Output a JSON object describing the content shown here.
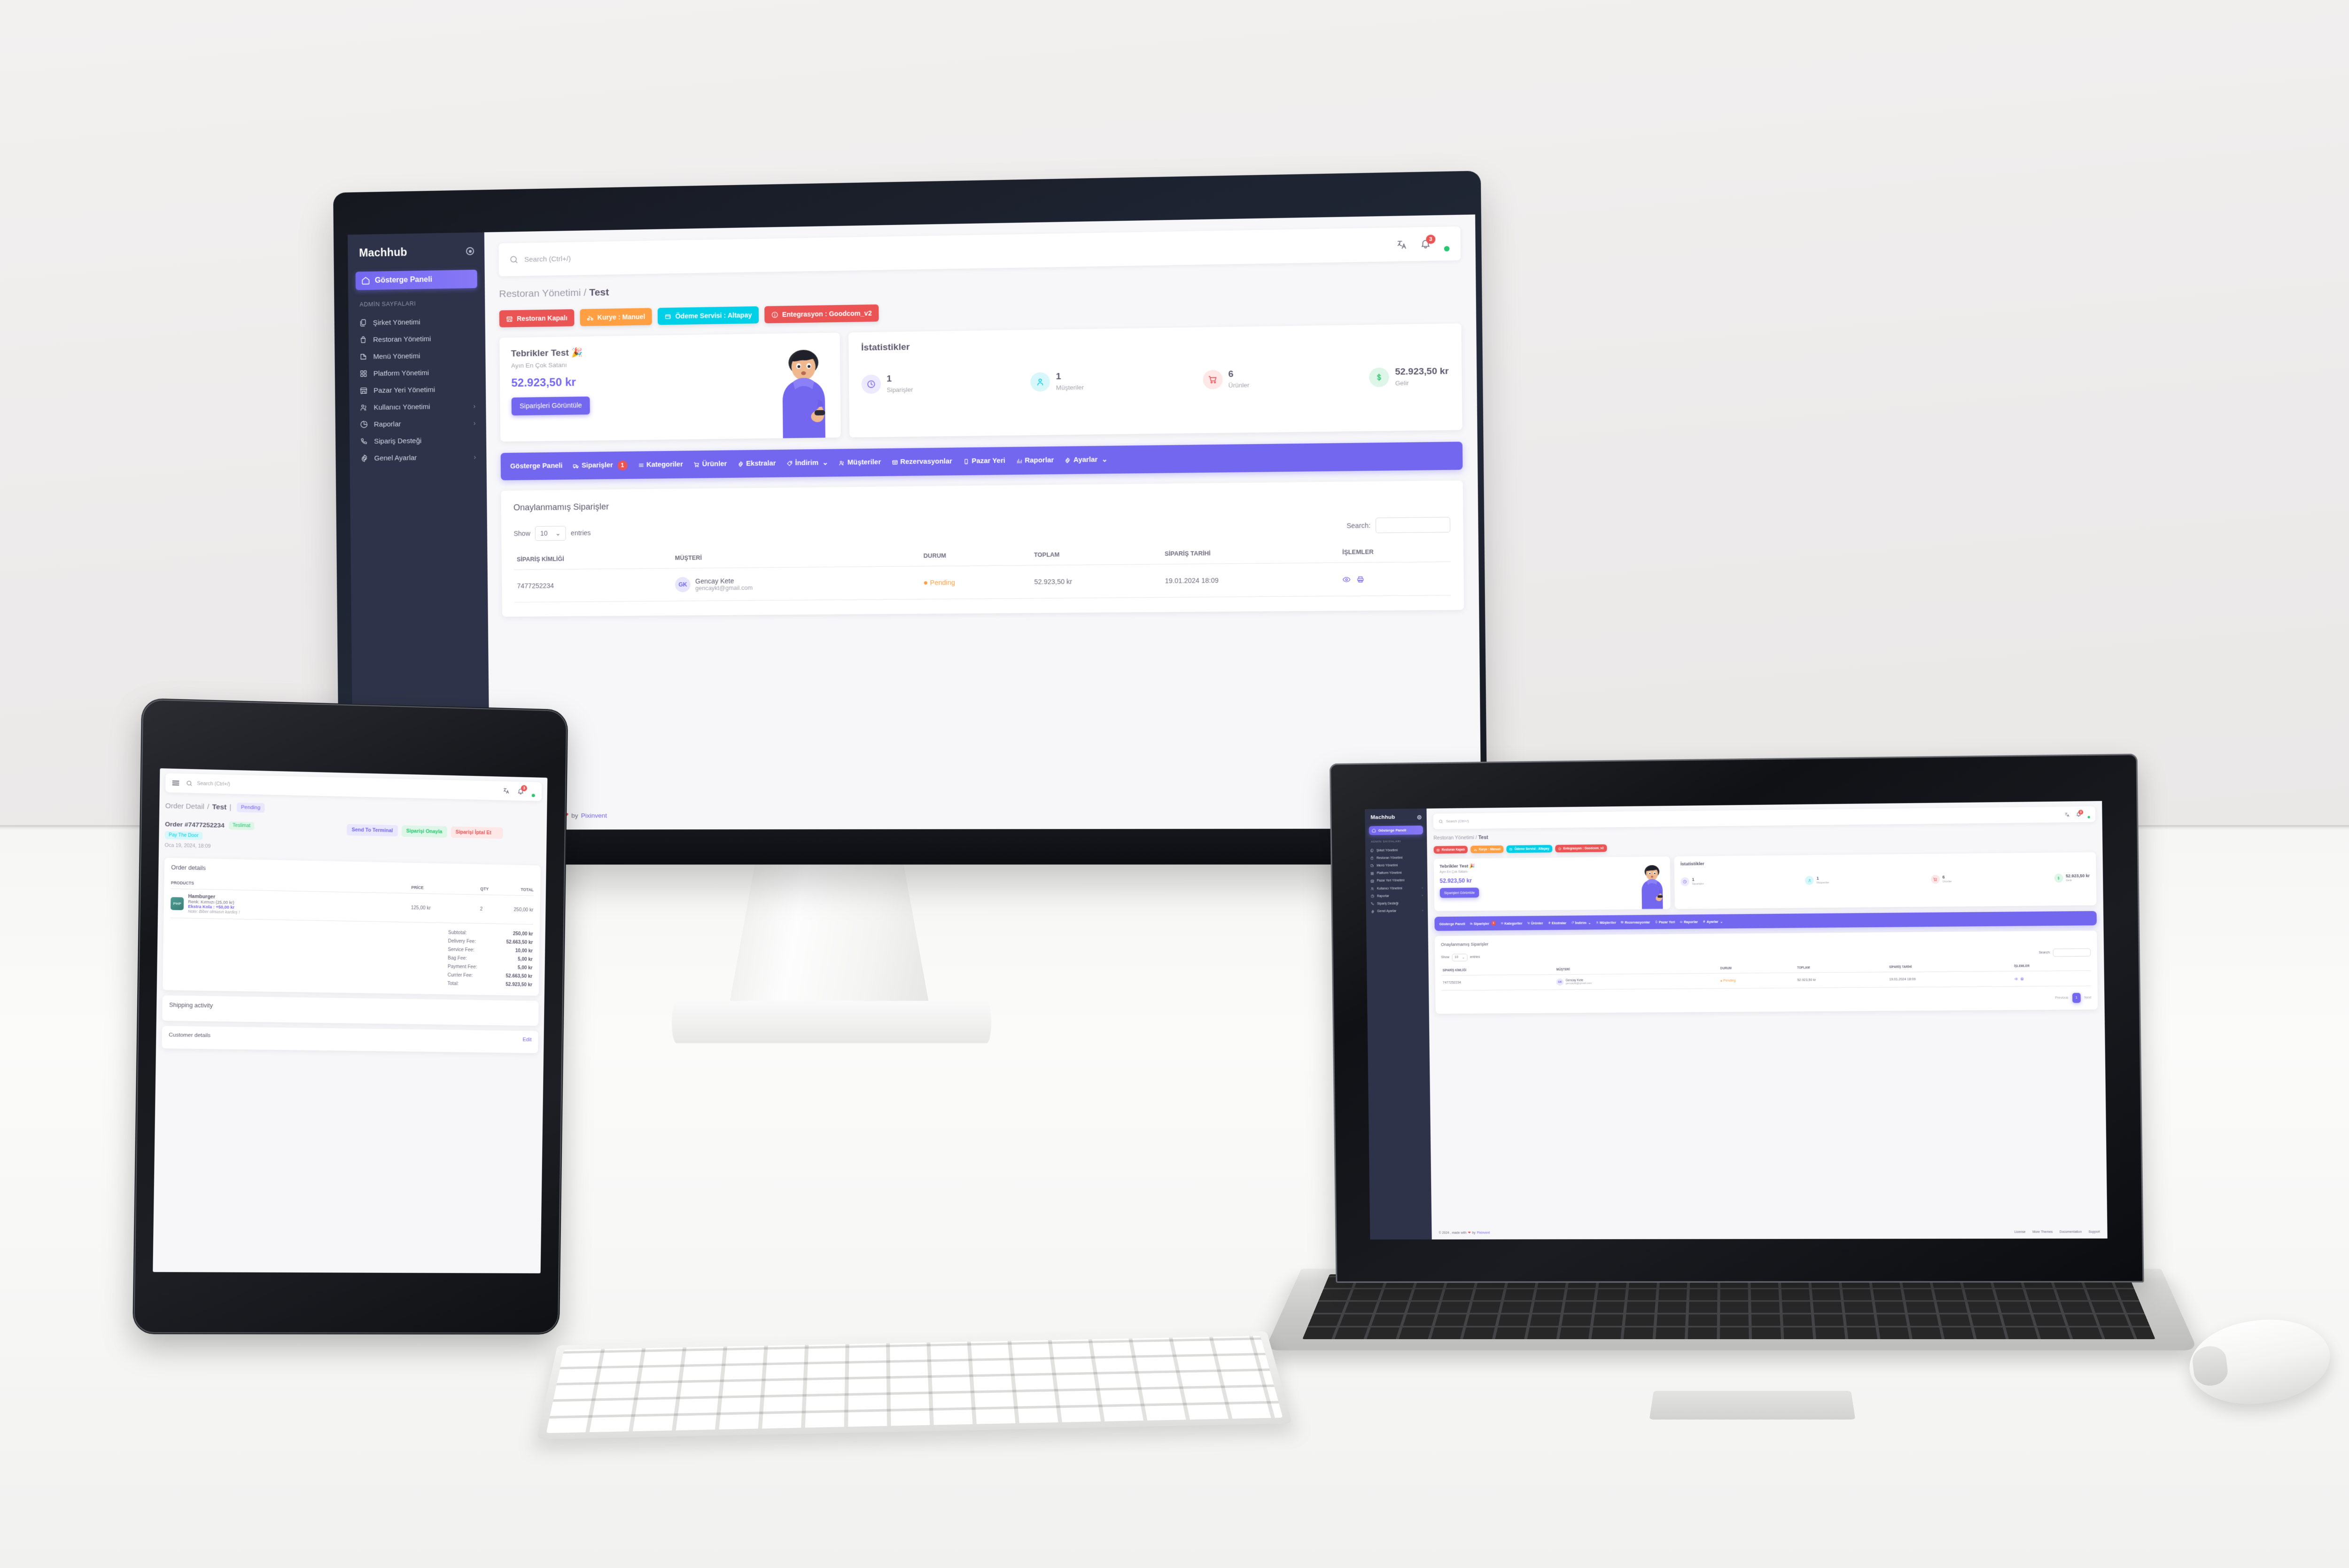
{
  "brand": {
    "name": "Machhub",
    "accent": "#7367f0"
  },
  "sidebar": {
    "active_label": "Gösterge Paneli",
    "section_header": "ADMİN SAYFALARI",
    "items": [
      {
        "label": "Şirket Yönetimi",
        "icon": "copy-icon",
        "chevron": ""
      },
      {
        "label": "Restoran Yönetimi",
        "icon": "shop-bag-icon",
        "chevron": ""
      },
      {
        "label": "Menü Yönetimi",
        "icon": "menu-book-icon",
        "chevron": ""
      },
      {
        "label": "Platform Yönetimi",
        "icon": "grid-icon",
        "chevron": ""
      },
      {
        "label": "Pazar Yeri Yönetimi",
        "icon": "store-icon",
        "chevron": ""
      },
      {
        "label": "Kullanıcı Yönetimi",
        "icon": "users-icon",
        "chevron": "›"
      },
      {
        "label": "Raporlar",
        "icon": "pie-chart-icon",
        "chevron": "›"
      },
      {
        "label": "Sipariş Desteği",
        "icon": "phone-icon",
        "chevron": ""
      },
      {
        "label": "Genel Ayarlar",
        "icon": "gear-icon",
        "chevron": "›"
      }
    ]
  },
  "topbar": {
    "search_placeholder": "Search (Ctrl+/)",
    "notification_count": "3",
    "translate_icon": "translate-icon",
    "bell_icon": "bell-icon",
    "status": "online"
  },
  "breadcrumb": {
    "parent": "Restoran Yönetimi",
    "sep": "/",
    "current": "Test"
  },
  "chips": [
    {
      "label": "Restoran Kapalı",
      "color": "red",
      "icon": "store-icon"
    },
    {
      "label": "Kurye : Manuel",
      "color": "orange",
      "icon": "bike-icon"
    },
    {
      "label": "Ödeme Servisi : Altapay",
      "color": "cyan",
      "icon": "wallet-icon"
    },
    {
      "label": "Entegrasyon : Goodcom_v2",
      "color": "red",
      "icon": "info-icon"
    }
  ],
  "congrats": {
    "title": "Tebrikler Test 🎉",
    "subtitle": "Ayın En Çok Satanı",
    "amount": "52.923,50 kr",
    "button": "Siparişleri Görüntüle"
  },
  "stats": {
    "title": "İstatistikler",
    "items": [
      {
        "value": "1",
        "label": "Siparişler",
        "tone": "purple",
        "icon": "clock-icon"
      },
      {
        "value": "1",
        "label": "Müşteriler",
        "tone": "cyan",
        "icon": "customer-icon"
      },
      {
        "value": "6",
        "label": "Ürünler",
        "tone": "red",
        "icon": "cart-icon"
      },
      {
        "value": "52.923,50 kr",
        "label": "Gelir",
        "tone": "green",
        "icon": "dollar-icon"
      }
    ]
  },
  "navpill": {
    "items": [
      {
        "label": "Gösterge Paneli",
        "icon": "",
        "badge": "",
        "caret": ""
      },
      {
        "label": "Siparişler",
        "icon": "truck-icon",
        "badge": "1",
        "caret": ""
      },
      {
        "label": "Kategoriler",
        "icon": "list-icon",
        "badge": "",
        "caret": ""
      },
      {
        "label": "Ürünler",
        "icon": "cart-icon",
        "badge": "",
        "caret": ""
      },
      {
        "label": "Ekstralar",
        "icon": "gear-icon",
        "badge": "",
        "caret": ""
      },
      {
        "label": "İndirim",
        "icon": "tag-icon",
        "badge": "",
        "caret": "⌄"
      },
      {
        "label": "Müşteriler",
        "icon": "users-icon",
        "badge": "",
        "caret": ""
      },
      {
        "label": "Rezervasyonlar",
        "icon": "table-icon",
        "badge": "",
        "caret": ""
      },
      {
        "label": "Pazar Yeri",
        "icon": "mobile-icon",
        "badge": "",
        "caret": ""
      },
      {
        "label": "Raporlar",
        "icon": "bars-icon",
        "badge": "",
        "caret": ""
      },
      {
        "label": "Ayarlar",
        "icon": "gear-icon",
        "badge": "",
        "caret": "⌄"
      }
    ]
  },
  "orders_table": {
    "title": "Onaylanmamış Siparişler",
    "show_label": "Show",
    "show_value": "10",
    "entries_label": "entries",
    "search_label": "Search:",
    "search_value": "",
    "columns": [
      "SİPARİŞ KİMLİĞİ",
      "MÜŞTERİ",
      "DURUM",
      "TOPLAM",
      "SİPARİŞ TARİHİ",
      "İŞLEMLER"
    ],
    "rows": [
      {
        "order_id": "7477252234",
        "customer_initials": "GK",
        "customer_name": "Gencay Kete",
        "customer_email": "gencaykt@gmail.com",
        "status": "Pending",
        "total": "52.923,50 kr",
        "date": "19.01.2024 18:09",
        "actions": [
          "eye-icon",
          "print-icon"
        ]
      }
    ],
    "pagination": {
      "previous": "Previous",
      "current": "1",
      "next": "Next"
    }
  },
  "footer": {
    "copyright_pre": "© 2024 , made with",
    "heart": "❤",
    "copyright_mid": "by",
    "author": "Pixinvent",
    "links": [
      "License",
      "More Themes"
    ],
    "links_laptop": [
      "License",
      "More Themes",
      "Documentation",
      "Support"
    ]
  },
  "tablet": {
    "search_placeholder": "Search (Ctrl+/)",
    "notification_count": "3",
    "breadcrumb": {
      "parent": "Order Detail",
      "sep": "/",
      "current": "Test",
      "pipe": "|"
    },
    "status_tag": "Pending",
    "order_number": "Order #7477252234",
    "tag_delivery": "Teslimat",
    "tag_payment": "Pay The Door",
    "order_date": "Oca 19, 2024, 18:09",
    "actions": [
      {
        "label": "Send To Terminal",
        "tone": "purple"
      },
      {
        "label": "Siparişi Onayla",
        "tone": "green"
      },
      {
        "label": "Siparişi İptal Et",
        "tone": "red"
      }
    ],
    "order_details_title": "Order details",
    "columns": [
      "PRODUCTS",
      "PRİCE",
      "QTY",
      "TOTAL"
    ],
    "product": {
      "icon_label": "PHP",
      "name": "Hamburger",
      "option": "Renk: Kırmızı (25,00 kr)",
      "extra": "Ekstra Kola : +50,00 kr",
      "note": "Note: Biber olmasın kardeş !",
      "price": "125,00 kr",
      "qty": "2",
      "total": "250,00 kr"
    },
    "totals": [
      {
        "label": "Subtotal:",
        "value": "250,00 kr"
      },
      {
        "label": "Delivery Fee:",
        "value": "52.663,50 kr"
      },
      {
        "label": "Service Fee:",
        "value": "10,00 kr"
      },
      {
        "label": "Bag Fee:",
        "value": "5,00 kr"
      },
      {
        "label": "Payment Fee:",
        "value": "5,00 kr"
      },
      {
        "label": "Currier Fee:",
        "value": "52.663,50 kr"
      },
      {
        "label": "Total:",
        "value": "52.923,50 kr"
      }
    ],
    "shipping_title": "Shipping activity",
    "customer_title": "Customer details",
    "edit_label": "Edit"
  }
}
